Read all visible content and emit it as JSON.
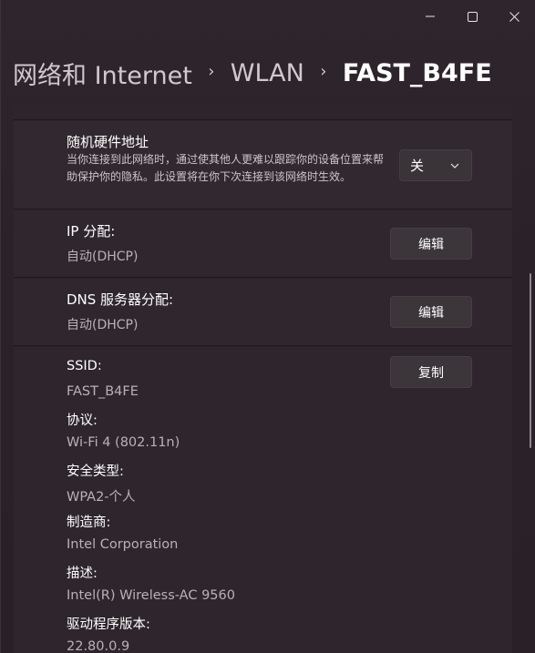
{
  "window": {
    "controls": {
      "minimize": "minimize-icon",
      "maximize": "maximize-icon",
      "close": "close-icon"
    }
  },
  "breadcrumb": {
    "items": [
      "网络和 Internet",
      "WLAN",
      "FAST_B4FE"
    ],
    "separator": "›"
  },
  "mac_address": {
    "title": "随机硬件地址",
    "description": "当你连接到此网络时，通过使其他人更难以跟踪你的设备位置来帮助保护你的隐私。此设置将在你下次连接到该网络时生效。",
    "select_value": "关"
  },
  "ip_assignment": {
    "title": "IP 分配:",
    "value": "自动(DHCP)",
    "button": "编辑"
  },
  "dns_assignment": {
    "title": "DNS 服务器分配:",
    "value": "自动(DHCP)",
    "button": "编辑"
  },
  "properties": {
    "copy_button": "复制",
    "items": [
      {
        "label": "SSID:",
        "value": "FAST_B4FE"
      },
      {
        "label": "协议:",
        "value": "Wi-Fi 4 (802.11n)"
      },
      {
        "label": "安全类型:",
        "value": "WPA2-个人"
      },
      {
        "label": "制造商:",
        "value": "Intel Corporation"
      },
      {
        "label": "描述:",
        "value": "Intel(R) Wireless-AC 9560"
      },
      {
        "label": "驱动程序版本:",
        "value": "22.80.0.9"
      }
    ]
  }
}
